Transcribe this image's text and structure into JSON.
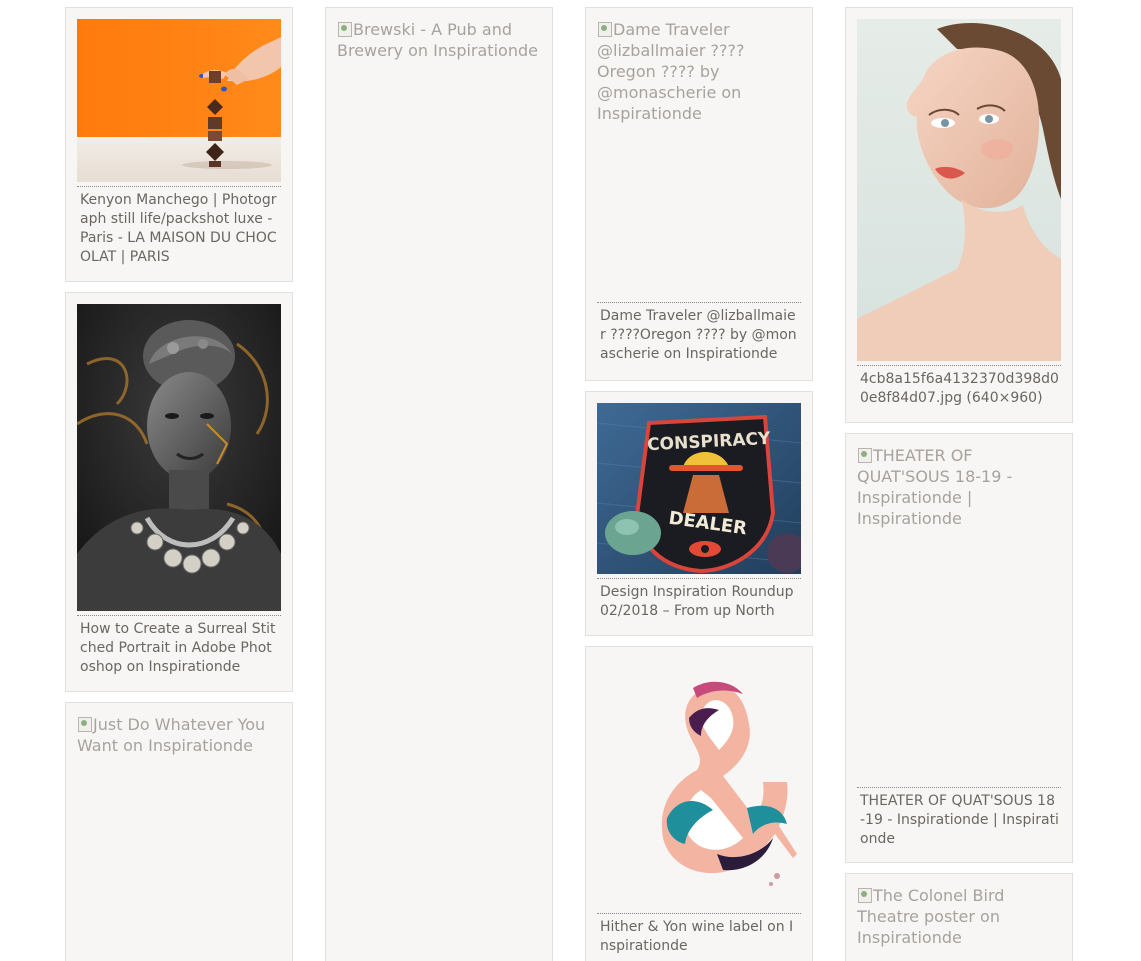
{
  "cards": [
    {
      "alt": "",
      "caption": "Kenyon Manchego | Photograph still life/packshot luxe - Paris - LA MAISON DU CHOCOLAT | PARIS"
    },
    {
      "alt": "",
      "caption": "How to Create a Surreal Stitched Portrait in Adobe Photoshop on Inspirationde"
    },
    {
      "alt": "Just Do Whatever You Want on Inspirationde",
      "caption": ""
    },
    {
      "alt": "Brewski - A Pub and Brewery on Inspirationde",
      "caption": ""
    },
    {
      "alt": "Dame Traveler @lizballmaier ????Oregon ???? by @monascherie on Inspirationde",
      "caption": "Dame Traveler @lizballmaier ????Oregon ???? by @monascherie on Inspirationde"
    },
    {
      "alt": "",
      "caption": "Design Inspiration Roundup 02/2018 – From up North",
      "patch_line1": "CONSPIRACY",
      "patch_line2": "DEALER"
    },
    {
      "alt": "",
      "caption": "Hither & Yon wine label on Inspirationde"
    },
    {
      "alt": "",
      "caption": "4cb8a15f6a4132370d398d00e8f84d07.jpg (640×960)"
    },
    {
      "alt": "THEATER OF QUAT'SOUS 18-19 - Inspirationde | Inspirationde",
      "caption": "THEATER OF QUAT'SOUS 18-19 - Inspirationde | Inspirationde"
    },
    {
      "alt": "The Colonel Bird Theatre poster on Inspirationde",
      "caption": ""
    }
  ]
}
